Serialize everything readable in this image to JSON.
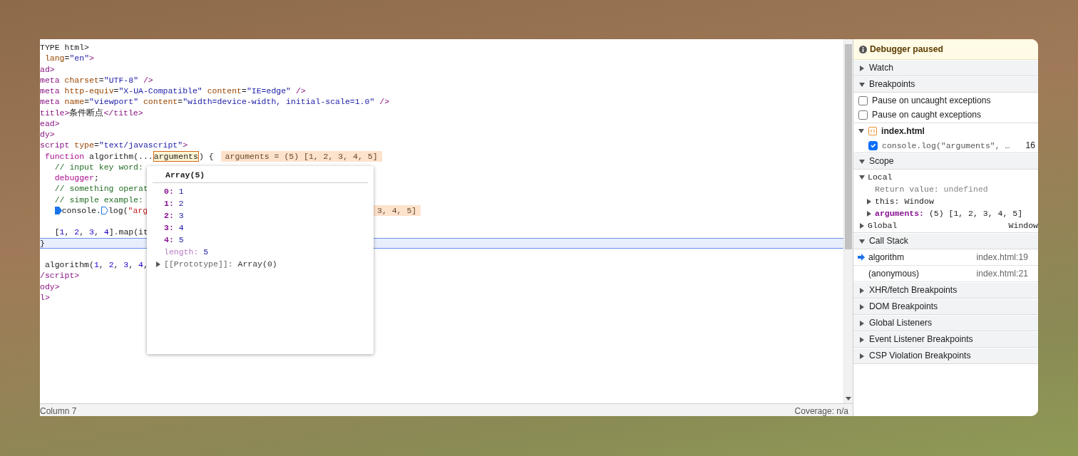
{
  "code": {
    "lines": [
      {
        "segments": [
          {
            "kind": "code",
            "tokens": [
              {
                "kind": "plain",
                "text": "TYPE html>"
              }
            ]
          }
        ]
      },
      {
        "segments": [
          {
            "kind": "code",
            "tokens": [
              {
                "kind": "attr",
                "text": " lang"
              },
              {
                "kind": "plain",
                "text": "="
              },
              {
                "kind": "value",
                "text": "\"en\""
              },
              {
                "kind": "tag",
                "text": ">"
              }
            ]
          }
        ]
      },
      {
        "segments": [
          {
            "kind": "code",
            "tokens": [
              {
                "kind": "tag",
                "text": "ad>"
              }
            ]
          }
        ]
      },
      {
        "segments": [
          {
            "kind": "code",
            "tokens": [
              {
                "kind": "tag",
                "text": "meta "
              },
              {
                "kind": "attr",
                "text": "charset"
              },
              {
                "kind": "plain",
                "text": "="
              },
              {
                "kind": "value",
                "text": "\"UTF-8\""
              },
              {
                "kind": "tag",
                "text": " />"
              }
            ]
          }
        ]
      },
      {
        "segments": [
          {
            "kind": "code",
            "tokens": [
              {
                "kind": "tag",
                "text": "meta "
              },
              {
                "kind": "attr",
                "text": "http-equiv"
              },
              {
                "kind": "plain",
                "text": "="
              },
              {
                "kind": "value",
                "text": "\"X-UA-Compatible\""
              },
              {
                "kind": "attr",
                "text": " content"
              },
              {
                "kind": "plain",
                "text": "="
              },
              {
                "kind": "value",
                "text": "\"IE=edge\""
              },
              {
                "kind": "tag",
                "text": " />"
              }
            ]
          }
        ]
      },
      {
        "segments": [
          {
            "kind": "code",
            "tokens": [
              {
                "kind": "tag",
                "text": "meta "
              },
              {
                "kind": "attr",
                "text": "name"
              },
              {
                "kind": "plain",
                "text": "="
              },
              {
                "kind": "value",
                "text": "\"viewport\""
              },
              {
                "kind": "attr",
                "text": " content"
              },
              {
                "kind": "plain",
                "text": "="
              },
              {
                "kind": "value",
                "text": "\"width=device-width, initial-scale=1.0\""
              },
              {
                "kind": "tag",
                "text": " />"
              }
            ]
          }
        ]
      },
      {
        "segments": [
          {
            "kind": "code",
            "tokens": [
              {
                "kind": "tag",
                "text": "title>"
              },
              {
                "kind": "plain",
                "text": "条件断点"
              },
              {
                "kind": "tag",
                "text": "</title>"
              }
            ]
          }
        ]
      },
      {
        "segments": [
          {
            "kind": "code",
            "tokens": [
              {
                "kind": "tag",
                "text": "ead>"
              }
            ]
          }
        ]
      },
      {
        "segments": [
          {
            "kind": "code",
            "tokens": [
              {
                "kind": "tag",
                "text": "dy>"
              }
            ]
          }
        ]
      },
      {
        "segments": [
          {
            "kind": "code",
            "tokens": [
              {
                "kind": "tag",
                "text": "script "
              },
              {
                "kind": "attr",
                "text": "type"
              },
              {
                "kind": "plain",
                "text": "="
              },
              {
                "kind": "value",
                "text": "\"text/javascript\""
              },
              {
                "kind": "tag",
                "text": ">"
              }
            ]
          }
        ]
      },
      {
        "segments": [
          {
            "kind": "code",
            "tokens": [
              {
                "kind": "keyword",
                "text": " function"
              },
              {
                "kind": "plain",
                "text": " algorithm(..."
              },
              {
                "kind": "hover",
                "text": "arguments"
              },
              {
                "kind": "plain",
                "text": ") {"
              }
            ]
          },
          {
            "kind": "inline_value",
            "covered": false,
            "text": "arguments = (5) [1, 2, 3, 4, 5]"
          }
        ]
      },
      {
        "segments": [
          {
            "kind": "code",
            "tokens": [
              {
                "kind": "comment",
                "text": "   // input key word:"
              }
            ]
          }
        ]
      },
      {
        "segments": [
          {
            "kind": "code",
            "tokens": [
              {
                "kind": "keyword",
                "text": "   debugger"
              },
              {
                "kind": "plain",
                "text": ";"
              }
            ]
          }
        ]
      },
      {
        "segments": [
          {
            "kind": "code",
            "tokens": [
              {
                "kind": "comment",
                "text": "   // something operat"
              }
            ]
          }
        ]
      },
      {
        "segments": [
          {
            "kind": "code",
            "tokens": [
              {
                "kind": "comment",
                "text": "   // simple example:"
              }
            ]
          }
        ]
      },
      {
        "segments": [
          {
            "kind": "indent"
          },
          {
            "kind": "breakpoint",
            "enabled": true
          },
          {
            "kind": "code",
            "tokens": [
              {
                "kind": "plain",
                "text": "console."
              }
            ]
          },
          {
            "kind": "breakpoint",
            "enabled": false
          },
          {
            "kind": "code",
            "tokens": [
              {
                "kind": "plain",
                "text": "log("
              },
              {
                "kind": "string",
                "text": "\"arg"
              }
            ]
          },
          {
            "kind": "inline_value",
            "covered": true,
            "text": "3, 4, 5]"
          }
        ]
      },
      {
        "blank": true
      },
      {
        "segments": [
          {
            "kind": "code",
            "tokens": [
              {
                "kind": "plain",
                "text": "   ["
              },
              {
                "kind": "number",
                "text": "1"
              },
              {
                "kind": "plain",
                "text": ", "
              },
              {
                "kind": "number",
                "text": "2"
              },
              {
                "kind": "plain",
                "text": ", "
              },
              {
                "kind": "number",
                "text": "3"
              },
              {
                "kind": "plain",
                "text": ", "
              },
              {
                "kind": "number",
                "text": "4"
              },
              {
                "kind": "plain",
                "text": "].map(it"
              }
            ]
          }
        ]
      },
      {
        "current": true,
        "segments": [
          {
            "kind": "code",
            "tokens": [
              {
                "kind": "plain",
                "text": "}"
              }
            ]
          }
        ]
      },
      {
        "blank": true
      },
      {
        "segments": [
          {
            "kind": "code",
            "tokens": [
              {
                "kind": "plain",
                "text": " algorithm("
              },
              {
                "kind": "number",
                "text": "1"
              },
              {
                "kind": "plain",
                "text": ", "
              },
              {
                "kind": "number",
                "text": "2"
              },
              {
                "kind": "plain",
                "text": ", "
              },
              {
                "kind": "number",
                "text": "3"
              },
              {
                "kind": "plain",
                "text": ", "
              },
              {
                "kind": "number",
                "text": "4"
              },
              {
                "kind": "plain",
                "text": ","
              }
            ]
          }
        ]
      },
      {
        "segments": [
          {
            "kind": "code",
            "tokens": [
              {
                "kind": "tag",
                "text": "/script>"
              }
            ]
          }
        ]
      },
      {
        "segments": [
          {
            "kind": "code",
            "tokens": [
              {
                "kind": "tag",
                "text": "ody>"
              }
            ]
          }
        ]
      },
      {
        "segments": [
          {
            "kind": "code",
            "tokens": [
              {
                "kind": "tag",
                "text": "l>"
              }
            ]
          }
        ]
      }
    ]
  },
  "popover": {
    "title": "Array(5)",
    "entries": [
      {
        "kind": "index",
        "key": "0:",
        "value": "1"
      },
      {
        "kind": "index",
        "key": "1:",
        "value": "2"
      },
      {
        "kind": "index",
        "key": "2:",
        "value": "3"
      },
      {
        "kind": "index",
        "key": "3:",
        "value": "4"
      },
      {
        "kind": "index",
        "key": "4:",
        "value": "5"
      },
      {
        "kind": "length",
        "key": "length:",
        "value": "5"
      },
      {
        "kind": "proto",
        "key": "[[Prototype]]:",
        "value": "Array(0)"
      }
    ]
  },
  "status_bar": {
    "left": "Column 7",
    "right": "Coverage: n/a"
  },
  "sidebar": {
    "banner": "Debugger paused",
    "sections": [
      {
        "title": "Watch",
        "expanded": false
      },
      {
        "kind": "breakpoints",
        "title": "Breakpoints",
        "expanded": true,
        "options": [
          {
            "label": "Pause on uncaught exceptions",
            "checked": false
          },
          {
            "label": "Pause on caught exceptions",
            "checked": false
          }
        ],
        "files": [
          {
            "name": "index.html",
            "expanded": true,
            "breakpoints": [
              {
                "code": "console.log(\"arguments\", …",
                "line": "16",
                "checked": true
              }
            ]
          }
        ]
      },
      {
        "kind": "scope",
        "title": "Scope",
        "expanded": true,
        "groups": [
          {
            "name": "Local",
            "expanded": true,
            "children": [
              {
                "kind": "value",
                "name": "Return value:",
                "value": "undefined"
              },
              {
                "kind": "object",
                "name": "this:",
                "value": "Window"
              },
              {
                "kind": "object",
                "name": "arguments:",
                "value": "(5) [1, 2, 3, 4, 5]",
                "highlight": true
              }
            ]
          },
          {
            "name": "Global",
            "expanded": false,
            "value": "Window"
          }
        ]
      },
      {
        "kind": "callstack",
        "title": "Call Stack",
        "expanded": true,
        "frames": [
          {
            "name": "algorithm",
            "location": "index.html:19",
            "selected": true
          },
          {
            "name": "(anonymous)",
            "location": "index.html:21",
            "selected": false
          }
        ]
      },
      {
        "title": "XHR/fetch Breakpoints",
        "expanded": false
      },
      {
        "title": "DOM Breakpoints",
        "expanded": false
      },
      {
        "title": "Global Listeners",
        "expanded": false
      },
      {
        "title": "Event Listener Breakpoints",
        "expanded": false
      },
      {
        "title": "CSP Violation Breakpoints",
        "expanded": false
      }
    ]
  }
}
